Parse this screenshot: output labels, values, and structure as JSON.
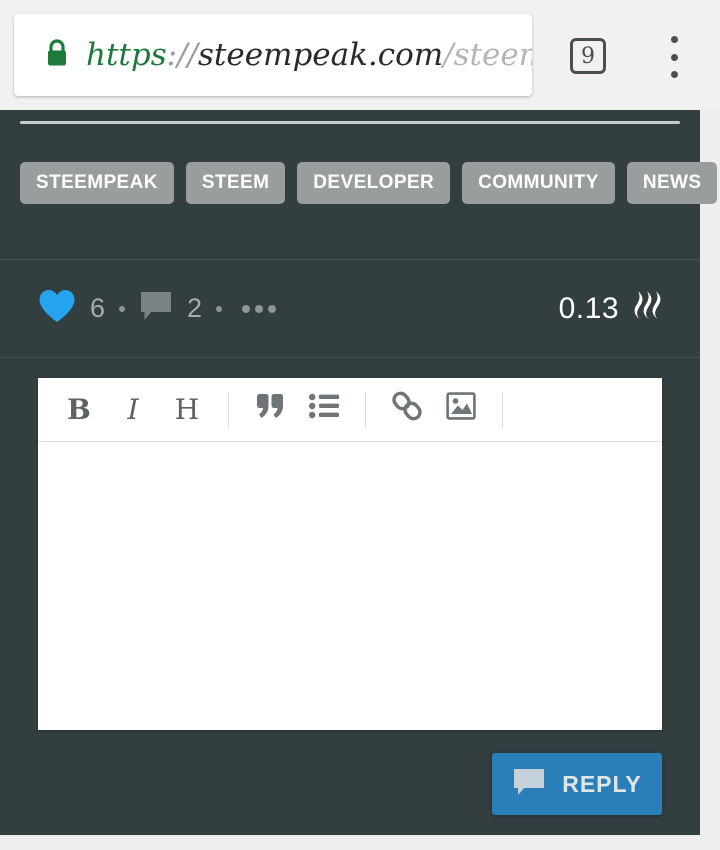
{
  "browser": {
    "lock_icon": "lock-icon",
    "url": {
      "scheme": "https",
      "separator": "://",
      "host": "steempeak.com",
      "path": "/steem"
    },
    "tab_count": "9",
    "menu_icon": "kebab-menu-icon"
  },
  "post": {
    "tags": [
      {
        "label": "STEEMPEAK"
      },
      {
        "label": "STEEM"
      },
      {
        "label": "DEVELOPER"
      },
      {
        "label": "COMMUNITY"
      },
      {
        "label": "NEWS"
      }
    ],
    "stats": {
      "vote_icon": "heart-icon",
      "vote_count": "6",
      "comment_icon": "comment-bubble-icon",
      "comment_count": "2",
      "more_icon": "ellipsis-icon",
      "payout": "0.13",
      "currency_icon": "steem-logo-icon"
    }
  },
  "editor": {
    "toolbar": [
      {
        "name": "bold-button",
        "label": "B"
      },
      {
        "name": "italic-button",
        "label": "I"
      },
      {
        "name": "heading-button",
        "label": "H"
      },
      {
        "name": "quote-button",
        "label": "“"
      },
      {
        "name": "bullet-list-button",
        "label": "list"
      },
      {
        "name": "link-button",
        "label": "link"
      },
      {
        "name": "image-button",
        "label": "image"
      }
    ],
    "textarea_value": "",
    "textarea_placeholder": ""
  },
  "reply": {
    "icon": "comment-bubble-icon",
    "label": "REPLY"
  },
  "colors": {
    "page_background": "#333e41",
    "chrome_background": "#f1f1f1",
    "tag_chip": "#9a9d9e",
    "vote_heart": "#26a3ef",
    "reply_button": "#2a7fb8",
    "lock_green": "#1e7a3c"
  }
}
